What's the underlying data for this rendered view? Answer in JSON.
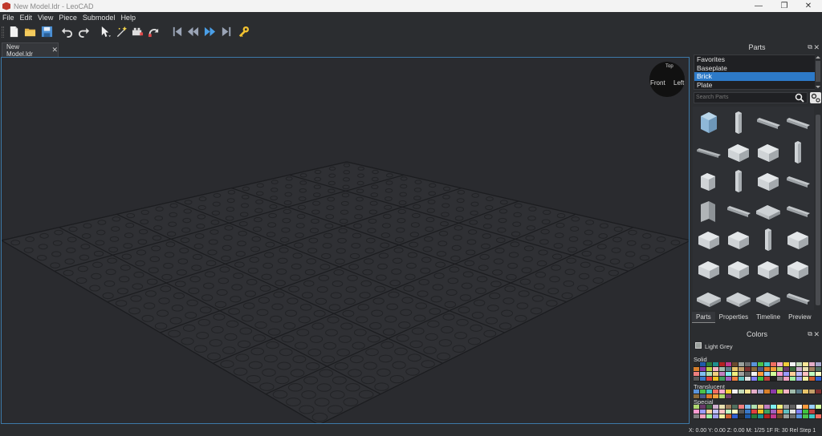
{
  "window": {
    "title": "New Model.ldr - LeoCAD",
    "minimize": "—",
    "maximize": "❐",
    "close": "✕"
  },
  "menu": [
    "File",
    "Edit",
    "View",
    "Piece",
    "Submodel",
    "Help"
  ],
  "toolbar": {
    "icons": [
      "new-file-icon",
      "open-folder-icon",
      "save-icon",
      "undo-icon",
      "redo-icon",
      "select-tool-icon",
      "magic-wand-icon",
      "insert-tool-icon",
      "rotate-tool-icon",
      "first-step-icon",
      "previous-step-icon",
      "next-step-icon",
      "last-step-icon",
      "key-icon"
    ]
  },
  "document_tab": {
    "label": "New Model.ldr",
    "close": "✕"
  },
  "viewcube": {
    "front": "Front",
    "left": "Left",
    "top": "Top"
  },
  "parts_panel": {
    "title": "Parts",
    "categories": [
      "Favorites",
      "Baseplate",
      "Brick",
      "Plate"
    ],
    "selected_category": "Brick",
    "search_placeholder": "Search Parts",
    "tabs": [
      "Parts",
      "Properties",
      "Timeline",
      "Preview"
    ],
    "active_tab": "Parts"
  },
  "colors_panel": {
    "title": "Colors",
    "current_color": "Light Grey",
    "sections": [
      "Solid",
      "Translucent",
      "Special"
    ]
  },
  "status": "X: 0.00 Y: 0.00 Z: 0.00   M: 1/25 1F R: 30 Rel   Step 1",
  "accent": "#2d7ac8"
}
